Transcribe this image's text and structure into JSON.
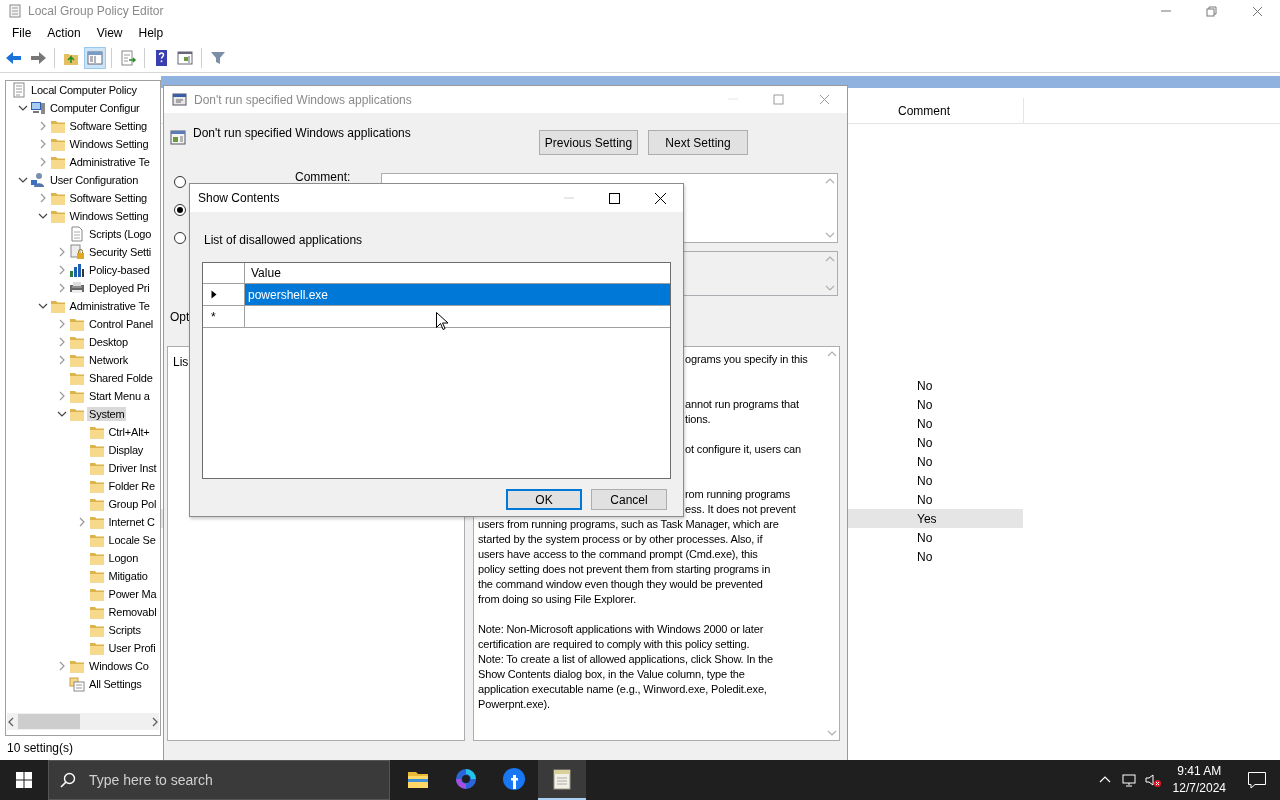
{
  "window": {
    "title": "Local Group Policy Editor",
    "active": false
  },
  "menu": [
    "File",
    "Action",
    "View",
    "Help"
  ],
  "toolbar": [
    {
      "kind": "back",
      "pressed": false
    },
    {
      "kind": "forward",
      "pressed": false
    },
    {
      "kind": "up",
      "pressed": false
    },
    {
      "kind": "tree",
      "pressed": true
    },
    {
      "kind": "export",
      "pressed": false
    },
    {
      "kind": "help",
      "pressed": false
    },
    {
      "kind": "view",
      "pressed": false
    },
    {
      "kind": "filter",
      "pressed": false
    }
  ],
  "tree": [
    {
      "label": "Local Computer Policy",
      "kind": "policy",
      "expandable": false,
      "expanded": false,
      "selected": false,
      "children": [
        {
          "label": "Computer Configur",
          "kind": "computer",
          "expandable": true,
          "expanded": true,
          "selected": false,
          "children": [
            {
              "label": "Software Setting",
              "kind": "folder",
              "expandable": true,
              "expanded": false,
              "selected": false
            },
            {
              "label": "Windows Setting",
              "kind": "folder",
              "expandable": true,
              "expanded": false,
              "selected": false
            },
            {
              "label": "Administrative Te",
              "kind": "folder",
              "expandable": true,
              "expanded": false,
              "selected": false
            }
          ]
        },
        {
          "label": "User Configuration",
          "kind": "user",
          "expandable": true,
          "expanded": true,
          "selected": false,
          "children": [
            {
              "label": "Software Setting",
              "kind": "folder",
              "expandable": true,
              "expanded": false,
              "selected": false
            },
            {
              "label": "Windows Setting",
              "kind": "folder",
              "expandable": true,
              "expanded": true,
              "selected": false,
              "children": [
                {
                  "label": "Scripts (Logo",
                  "kind": "scripts",
                  "expandable": false,
                  "expanded": false,
                  "selected": false
                },
                {
                  "label": "Security Setti",
                  "kind": "security",
                  "expandable": true,
                  "expanded": false,
                  "selected": false
                },
                {
                  "label": "Policy-based",
                  "kind": "chart",
                  "expandable": true,
                  "expanded": false,
                  "selected": false
                },
                {
                  "label": "Deployed Pri",
                  "kind": "printer",
                  "expandable": true,
                  "expanded": false,
                  "selected": false
                }
              ]
            },
            {
              "label": "Administrative Te",
              "kind": "folder",
              "expandable": true,
              "expanded": true,
              "selected": false,
              "children": [
                {
                  "label": "Control Panel",
                  "kind": "folder",
                  "expandable": true,
                  "expanded": false,
                  "selected": false
                },
                {
                  "label": "Desktop",
                  "kind": "folder",
                  "expandable": true,
                  "expanded": false,
                  "selected": false
                },
                {
                  "label": "Network",
                  "kind": "folder",
                  "expandable": true,
                  "expanded": false,
                  "selected": false
                },
                {
                  "label": "Shared Folde",
                  "kind": "folder",
                  "expandable": false,
                  "expanded": false,
                  "selected": false
                },
                {
                  "label": "Start Menu a",
                  "kind": "folder",
                  "expandable": true,
                  "expanded": false,
                  "selected": false
                },
                {
                  "label": "System",
                  "kind": "folder",
                  "expandable": true,
                  "expanded": true,
                  "selected": true,
                  "children": [
                    {
                      "label": "Ctrl+Alt+",
                      "kind": "folder",
                      "expandable": false,
                      "expanded": false,
                      "selected": false
                    },
                    {
                      "label": "Display",
                      "kind": "folder",
                      "expandable": false,
                      "expanded": false,
                      "selected": false
                    },
                    {
                      "label": "Driver Inst",
                      "kind": "folder",
                      "expandable": false,
                      "expanded": false,
                      "selected": false
                    },
                    {
                      "label": "Folder Re",
                      "kind": "folder",
                      "expandable": false,
                      "expanded": false,
                      "selected": false
                    },
                    {
                      "label": "Group Pol",
                      "kind": "folder",
                      "expandable": false,
                      "expanded": false,
                      "selected": false
                    },
                    {
                      "label": "Internet C",
                      "kind": "folder",
                      "expandable": true,
                      "expanded": false,
                      "selected": false
                    },
                    {
                      "label": "Locale Se",
                      "kind": "folder",
                      "expandable": false,
                      "expanded": false,
                      "selected": false
                    },
                    {
                      "label": "Logon",
                      "kind": "folder",
                      "expandable": false,
                      "expanded": false,
                      "selected": false
                    },
                    {
                      "label": "Mitigatio",
                      "kind": "folder",
                      "expandable": false,
                      "expanded": false,
                      "selected": false
                    },
                    {
                      "label": "Power Ma",
                      "kind": "folder",
                      "expandable": false,
                      "expanded": false,
                      "selected": false
                    },
                    {
                      "label": "Removabl",
                      "kind": "folder",
                      "expandable": false,
                      "expanded": false,
                      "selected": false
                    },
                    {
                      "label": "Scripts",
                      "kind": "folder",
                      "expandable": false,
                      "expanded": false,
                      "selected": false
                    },
                    {
                      "label": "User Profi",
                      "kind": "folder",
                      "expandable": false,
                      "expanded": false,
                      "selected": false
                    }
                  ]
                },
                {
                  "label": "Windows Co",
                  "kind": "folder",
                  "expandable": true,
                  "expanded": false,
                  "selected": false
                },
                {
                  "label": "All Settings",
                  "kind": "allsettings",
                  "expandable": false,
                  "expanded": false,
                  "selected": false
                }
              ]
            }
          ]
        }
      ]
    }
  ],
  "results": {
    "columns": [
      "Comment"
    ],
    "rows": [
      {
        "value": "No",
        "selected": false
      },
      {
        "value": "No",
        "selected": false
      },
      {
        "value": "No",
        "selected": false
      },
      {
        "value": "No",
        "selected": false
      },
      {
        "value": "No",
        "selected": false
      },
      {
        "value": "No",
        "selected": false
      },
      {
        "value": "No",
        "selected": false
      },
      {
        "value": "Yes",
        "selected": true
      },
      {
        "value": "No",
        "selected": false
      },
      {
        "value": "No",
        "selected": false
      }
    ]
  },
  "status_bar": "10 setting(s)",
  "policy_dialog": {
    "title": "Don't run specified Windows applications",
    "active": false,
    "heading": "Don't run specified Windows applications",
    "buttons": [
      "Previous Setting",
      "Next Setting"
    ],
    "radios": [
      {
        "selected": false
      },
      {
        "selected": true
      },
      {
        "selected": false
      }
    ],
    "comment_label": "Comment:",
    "options_label": "Opt",
    "options_text": "Lis",
    "help_fragments": [
      "ograms you specify in this",
      "annot run programs that",
      "tions.",
      "ot configure it, users can",
      "rom running programs",
      "ess. It does not prevent"
    ],
    "help_lines": [
      "users from running programs, such as Task Manager, which are",
      "started by the system process or by other processes.  Also, if",
      "users have access to the command prompt (Cmd.exe), this",
      "policy setting does not prevent them from starting programs in",
      "the command window even though they would be prevented",
      "from doing so using File Explorer.",
      "Note: Non-Microsoft applications with Windows 2000 or later",
      "certification are required to comply with this policy setting.",
      "Note: To create a list of allowed applications, click Show.  In the",
      "Show Contents dialog box, in the Value column, type the",
      "application executable name (e.g., Winword.exe, Poledit.exe,",
      "Powerpnt.exe)."
    ]
  },
  "show_contents": {
    "title": "Show Contents",
    "active": true,
    "label": "List of disallowed applications",
    "column": "Value",
    "rows": [
      {
        "kind": "current",
        "value": "powershell.exe",
        "selected": true
      },
      {
        "kind": "new",
        "marker": "*",
        "selected": false
      }
    ],
    "buttons": [
      {
        "label": "OK",
        "default": true
      },
      {
        "label": "Cancel",
        "default": false
      }
    ]
  },
  "taskbar": {
    "search": {
      "placeholder": "Type here to search"
    },
    "apps": [
      {
        "kind": "explorer",
        "open": false
      },
      {
        "kind": "swirl",
        "open": false
      },
      {
        "kind": "round",
        "open": false
      },
      {
        "kind": "notepad",
        "open": true
      }
    ],
    "time": "9:41 AM",
    "date": "12/7/2024"
  }
}
